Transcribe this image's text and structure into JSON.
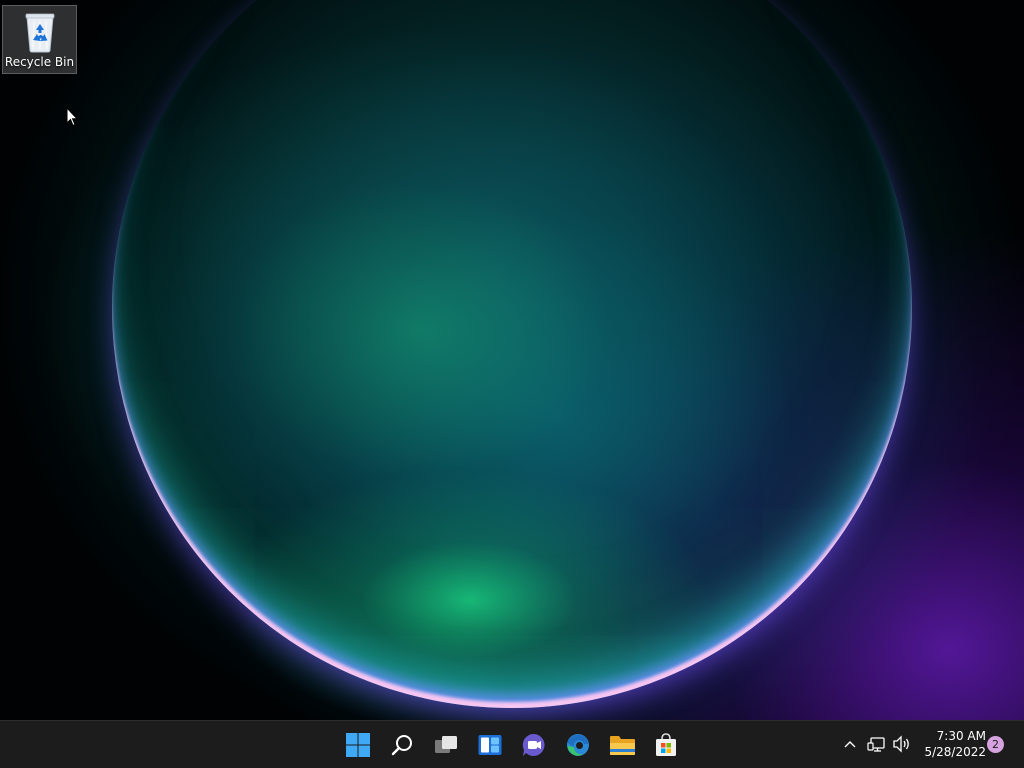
{
  "desktop": {
    "icons": [
      {
        "label": "Recycle Bin",
        "icon": "recycle-bin-icon"
      }
    ]
  },
  "taskbar": {
    "items": [
      {
        "name": "start",
        "icon": "windows-logo-icon"
      },
      {
        "name": "search",
        "icon": "search-icon"
      },
      {
        "name": "task-view",
        "icon": "task-view-icon"
      },
      {
        "name": "widgets",
        "icon": "widgets-icon"
      },
      {
        "name": "chat",
        "icon": "teams-chat-icon"
      },
      {
        "name": "edge",
        "icon": "edge-icon"
      },
      {
        "name": "file-explorer",
        "icon": "folder-icon"
      },
      {
        "name": "store",
        "icon": "store-icon"
      }
    ],
    "tray": {
      "icons": [
        "chevron-up-icon",
        "network-icon",
        "volume-icon"
      ],
      "time": "7:30 AM",
      "date": "5/28/2022",
      "notification_count": "2"
    }
  },
  "colors": {
    "taskbar_bg": "#1c1c1c",
    "accent": "#0078d4",
    "notification_badge": "#d6a2e0"
  }
}
